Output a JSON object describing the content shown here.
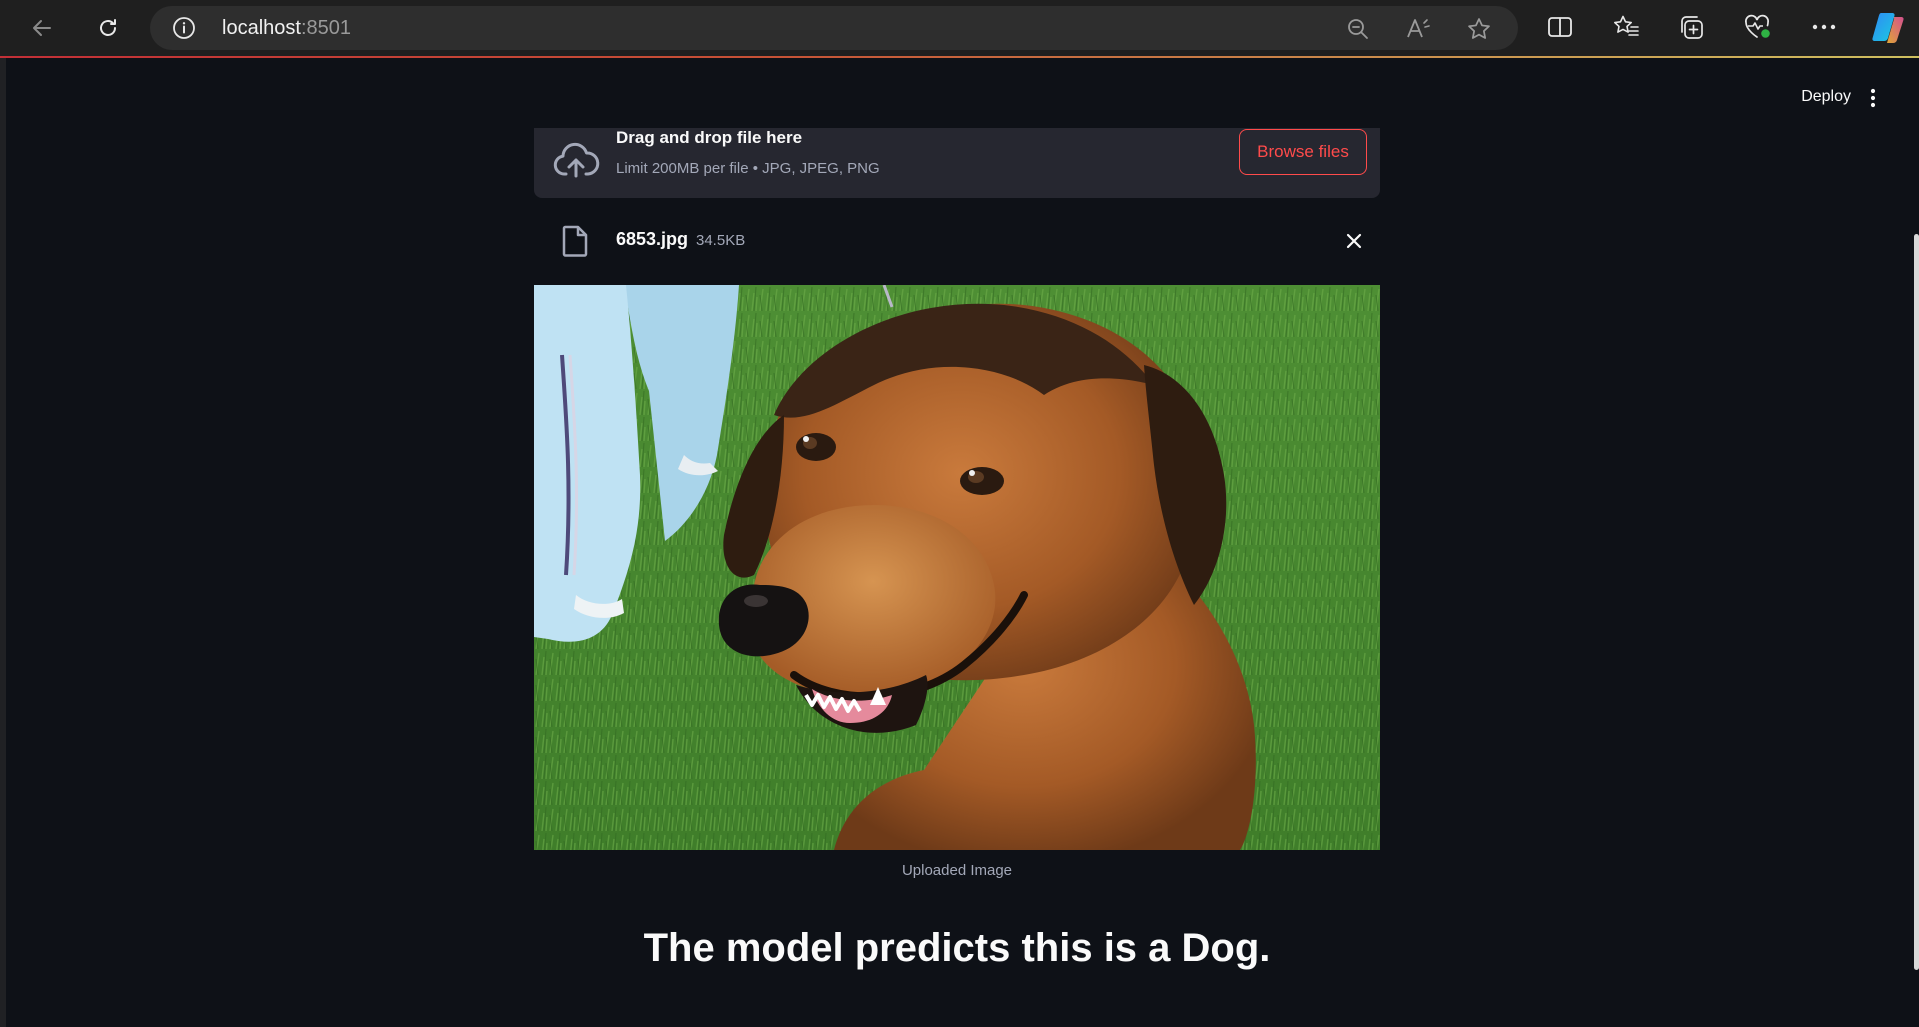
{
  "browser": {
    "url_host": "localhost",
    "url_port": ":8501",
    "icons": {
      "back": "back-arrow-icon",
      "reload": "reload-icon",
      "site_info": "info-icon",
      "zoom": "zoom-out-icon",
      "read_aloud": "read-aloud-icon",
      "favorite": "star-icon",
      "split_screen": "split-screen-icon",
      "favorites": "favorites-icon",
      "collections": "collections-icon",
      "browser_essentials": "heart-pulse-icon",
      "more": "more-icon",
      "copilot": "copilot-icon"
    },
    "accent_line_colors": [
      "#e0323a",
      "#eedc6a"
    ]
  },
  "app": {
    "header": {
      "deploy_label": "Deploy"
    },
    "uploader": {
      "title": "Drag and drop file here",
      "subtitle": "Limit 200MB per file • JPG, JPEG, PNG",
      "browse_label": "Browse files"
    },
    "file": {
      "name": "6853.jpg",
      "size": "34.5KB"
    },
    "image": {
      "caption": "Uploaded Image"
    },
    "prediction_text": "The model predicts this is a Dog.",
    "colors": {
      "background": "#0e1117",
      "panel": "#262730",
      "accent": "#ff4b4b",
      "text": "#fafafa",
      "muted": "#a3a8b8"
    }
  }
}
